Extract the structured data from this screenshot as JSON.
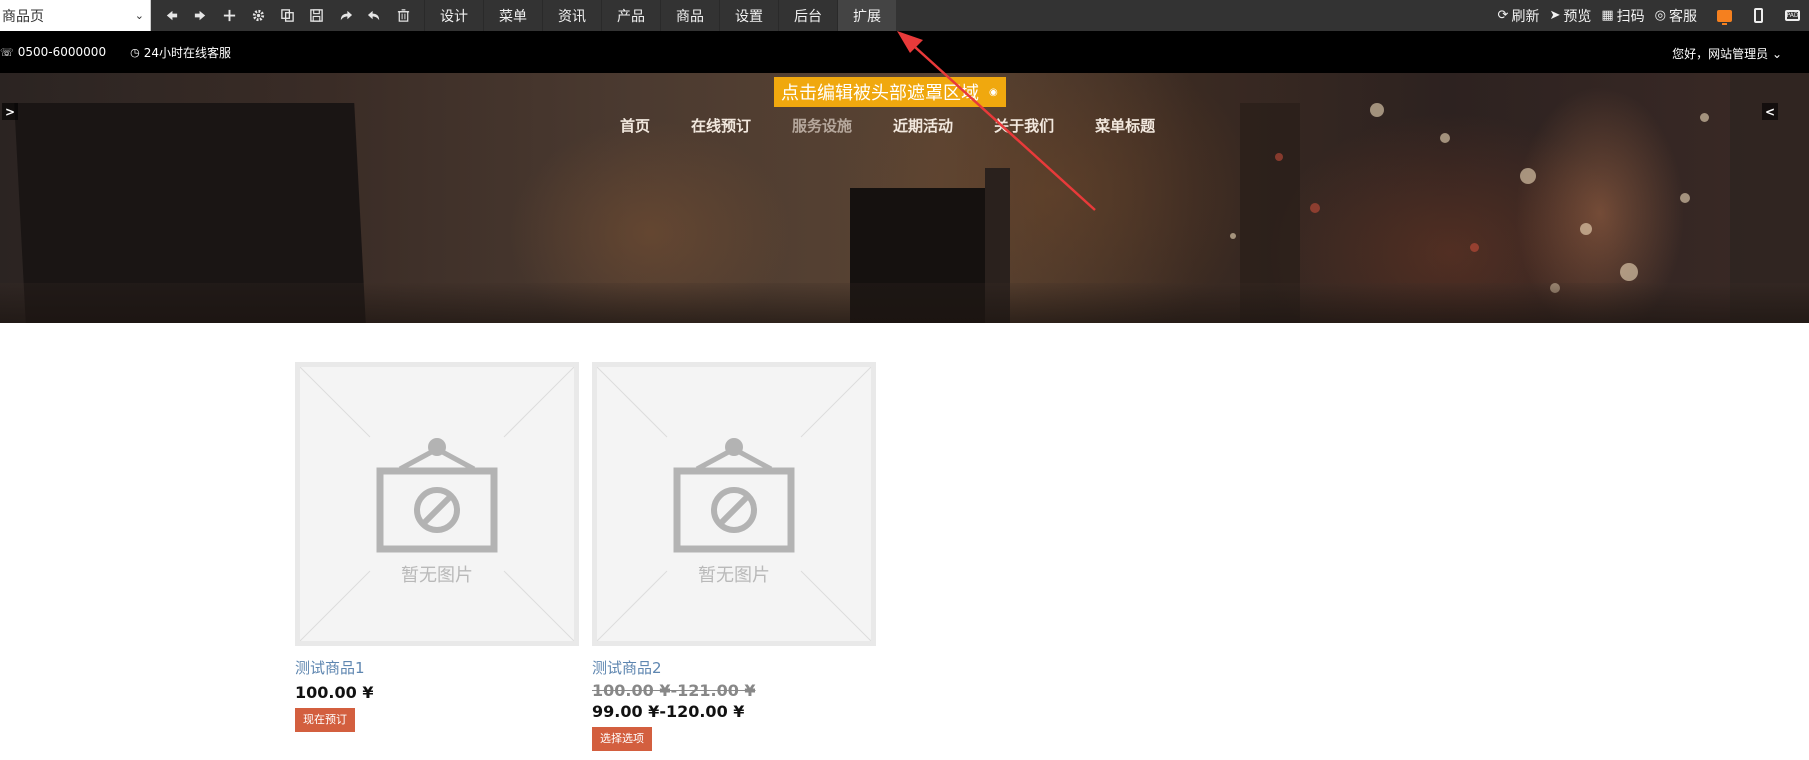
{
  "toolbar": {
    "page_select": "商品页",
    "tabs": [
      "设计",
      "菜单",
      "资讯",
      "产品",
      "商品",
      "设置",
      "后台",
      "扩展"
    ],
    "active_tab": "扩展",
    "right": {
      "refresh": "刷新",
      "preview": "预览",
      "scan": "扫码",
      "service": "客服"
    },
    "pad_label": "PAD"
  },
  "infobar": {
    "phone": "0500-6000000",
    "service_hours": "24小时在线客服",
    "greeting": "您好，网站管理员"
  },
  "banner": {
    "edit_mask_label": "点击编辑被头部遮罩区域",
    "nav": [
      "首页",
      "在线预订",
      "服务设施",
      "近期活动",
      "关于我们",
      "菜单标题"
    ],
    "arrow_left": ">",
    "arrow_right": "<"
  },
  "products": [
    {
      "no_image_text": "暂无图片",
      "name": "测试商品1",
      "price": "100.00 ¥",
      "button": "现在预订"
    },
    {
      "no_image_text": "暂无图片",
      "name": "测试商品2",
      "old_price": "100.00 ¥-121.00 ¥",
      "price": "99.00 ¥-120.00 ¥",
      "button": "选择选项"
    }
  ],
  "colors": {
    "toolbar_bg": "#333333",
    "accent_orange": "#f0a80e",
    "button_red": "#d35f3f",
    "link_blue": "#5e86b0",
    "annotation_red": "#e83a3a"
  }
}
